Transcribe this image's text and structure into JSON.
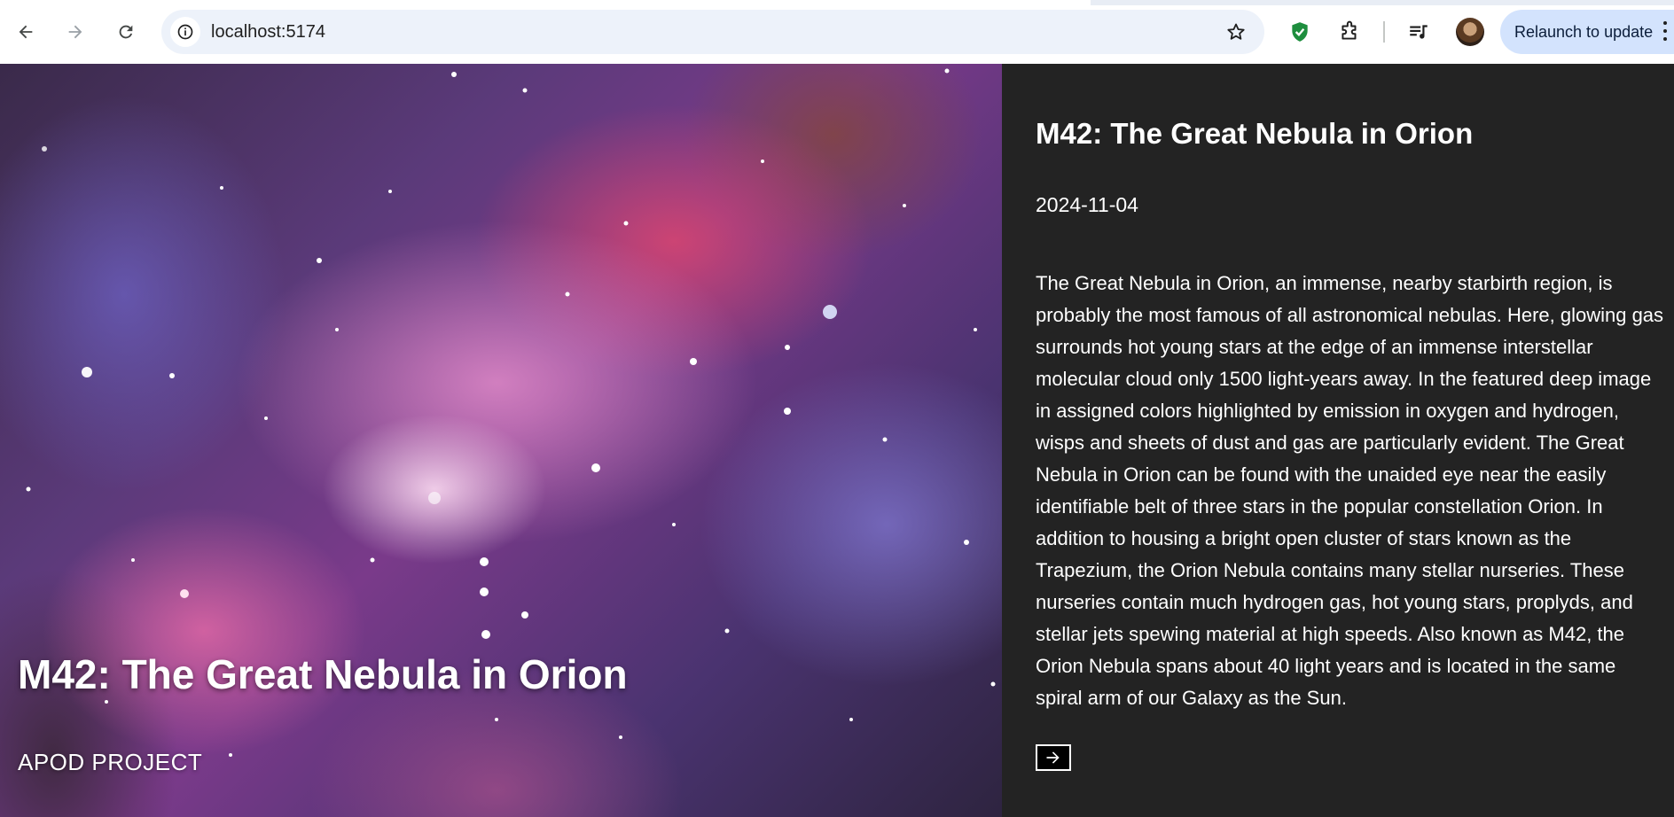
{
  "browser": {
    "url": "localhost:5174",
    "relaunch_label": "Relaunch to update",
    "icons": {
      "back": "arrow-left-icon",
      "forward": "arrow-right-icon",
      "reload": "reload-icon",
      "site_info": "info-icon",
      "bookmark": "star-icon",
      "extension_shield": "shield-check-icon",
      "extensions": "puzzle-icon",
      "media": "media-queue-icon",
      "menu": "more-vert-icon"
    }
  },
  "hero": {
    "title": "M42: The Great Nebula in Orion",
    "project_label": "APOD PROJECT"
  },
  "details": {
    "title": "M42: The Great Nebula in Orion",
    "date": "2024-11-04",
    "explanation": "The Great Nebula in Orion, an immense, nearby starbirth region, is probably the most famous of all astronomical nebulas. Here, glowing gas surrounds hot young stars at the edge of an immense interstellar molecular cloud only 1500 light-years away. In the featured deep image in assigned colors highlighted by emission in oxygen and hydrogen, wisps and sheets of dust and gas are particularly evident. The Great Nebula in Orion can be found with the unaided eye near the easily identifiable belt of three stars in the popular constellation Orion. In addition to housing a bright open cluster of stars known as the Trapezium, the Orion Nebula contains many stellar nurseries. These nurseries contain much hydrogen gas, hot young stars, proplyds, and stellar jets spewing material at high speeds. Also known as M42, the Orion Nebula spans about 40 light years and is located in the same spiral arm of our Galaxy as the Sun.",
    "next_icon": "arrow-right-icon"
  },
  "colors": {
    "panel_bg": "#232323",
    "omnibox_bg": "#edf2fa",
    "relaunch_bg": "#d3e3fd",
    "shield_green": "#1e8e3e"
  }
}
